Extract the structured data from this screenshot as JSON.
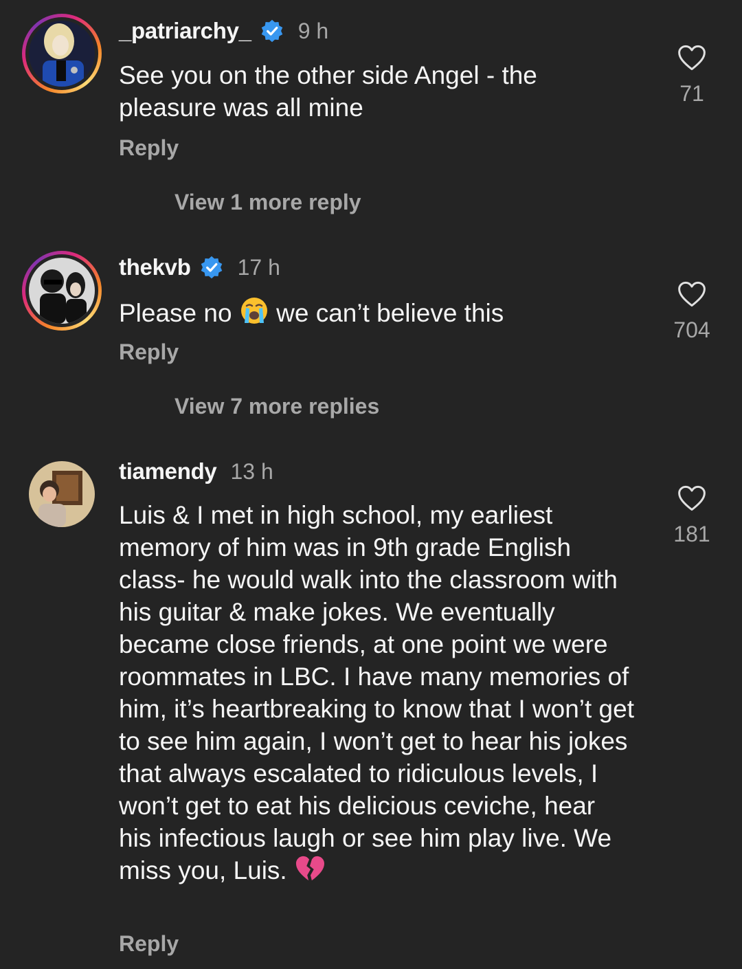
{
  "comments": [
    {
      "username": "_patriarchy_",
      "verified": true,
      "time": "9 h",
      "text": "See you on the other side Angel - the pleasure was all mine",
      "reply_label": "Reply",
      "view_more": "View 1 more reply",
      "likes": "71"
    },
    {
      "username": "thekvb",
      "verified": true,
      "time": "17 h",
      "text_before": "Please no",
      "emoji": "loudly-crying-face",
      "text_after": "we can’t believe this",
      "reply_label": "Reply",
      "view_more": "View 7 more replies",
      "likes": "704"
    },
    {
      "username": "tiamendy",
      "verified": false,
      "time": "13 h",
      "text": "Luis & I met in high school, my earliest memory of him was in 9th grade English class- he would walk into the classroom with his guitar & make jokes. We eventually became close friends, at one point we were roommates in LBC. I have many memories of him, it’s heartbreaking to know that I won’t get to see him again, I won’t get to hear his jokes that always escalated to ridiculous levels, I won’t get to eat his delicious ceviche, hear his infectious laugh or see him play live. We miss you, Luis.",
      "emoji": "broken-heart",
      "reply_label": "Reply",
      "likes": "181"
    }
  ],
  "colors": {
    "background": "#242424",
    "text": "#f5f5f5",
    "secondary": "#a8a8a8",
    "verified": "#3897f0",
    "broken_heart": "#e84a8a"
  }
}
